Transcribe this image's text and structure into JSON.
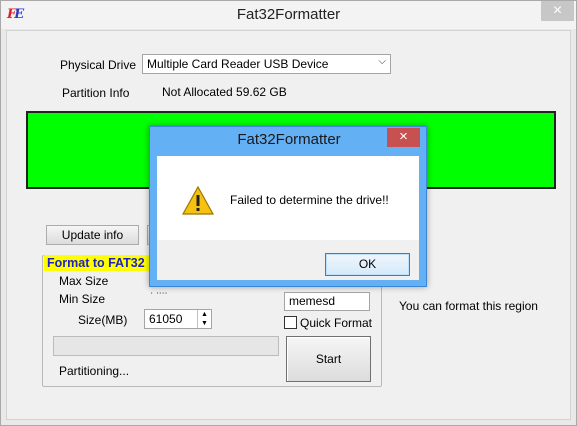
{
  "window": {
    "title": "Fat32Formatter",
    "icon_text_a": "F",
    "icon_text_b": "E",
    "close_glyph": "×"
  },
  "main": {
    "physical_drive_label": "Physical Drive",
    "physical_drive_value": "Multiple Card  Reader USB Device",
    "partition_info_label": "Partition Info",
    "partition_info_value": "Not Allocated  59.62 GB",
    "update_info_button": "Update info",
    "group_title": "Format to FAT32",
    "max_size_label": "Max Size",
    "min_size_label": "Min Size",
    "min_size_value_partial": "ᐧ ᐧᐧᐧᐧ",
    "size_mb_label": "Size(MB)",
    "size_mb_value": "61050",
    "volume_label_value": "memesd",
    "quick_format_label": "Quick Format",
    "start_button": "Start",
    "status_text": "Partitioning...",
    "region_hint": "You can format this region",
    "partition_color": "#00ff00"
  },
  "dialog": {
    "title": "Fat32Formatter",
    "message": "Failed to determine the drive!!",
    "ok_button": "OK",
    "close_glyph": "×",
    "icon": "warning-icon"
  }
}
